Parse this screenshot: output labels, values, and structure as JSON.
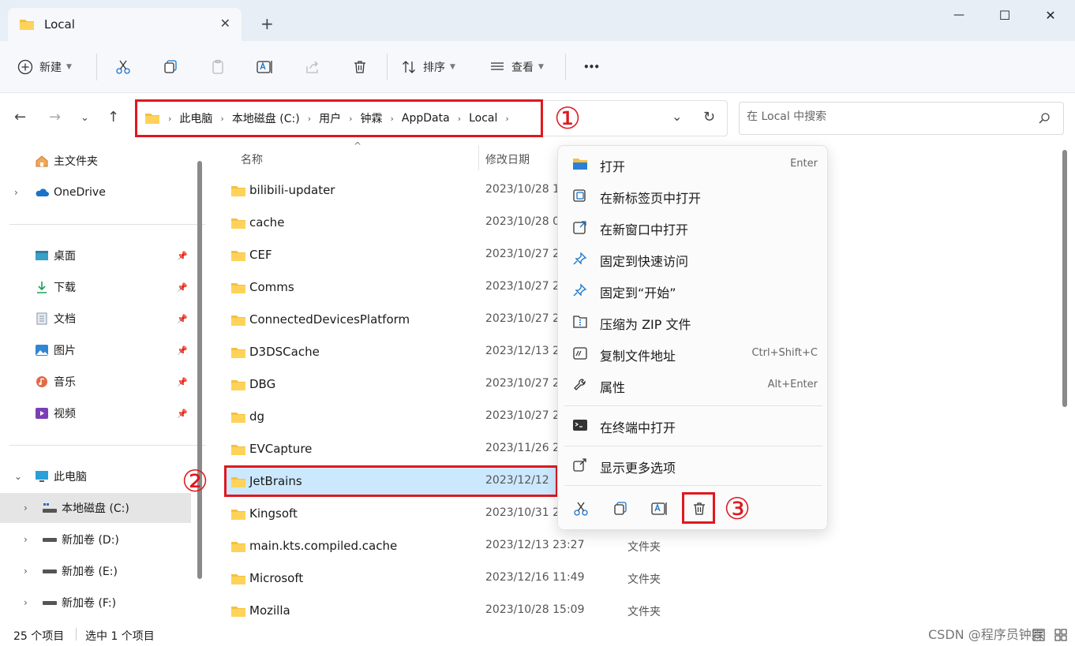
{
  "window": {
    "tab_title": "Local",
    "new_tab": "+",
    "close_tab": "✕",
    "minimize": "—",
    "maximize": "☐",
    "close": "✕"
  },
  "toolbar": {
    "new_label": "新建",
    "sort_label": "排序",
    "view_label": "查看",
    "more_label": "•••"
  },
  "address": {
    "crumbs": [
      "此电脑",
      "本地磁盘 (C:)",
      "用户",
      "钟霖",
      "AppData",
      "Local"
    ],
    "annotation": "①"
  },
  "search": {
    "placeholder": "在 Local 中搜索"
  },
  "sidebar": {
    "items": [
      {
        "label": "主文件夹",
        "icon": "home-icon"
      },
      {
        "label": "OneDrive",
        "icon": "cloud-icon"
      },
      {
        "label": "桌面",
        "icon": "desktop-icon"
      },
      {
        "label": "下载",
        "icon": "download-icon"
      },
      {
        "label": "文档",
        "icon": "document-icon"
      },
      {
        "label": "图片",
        "icon": "pictures-icon"
      },
      {
        "label": "音乐",
        "icon": "music-icon"
      },
      {
        "label": "视频",
        "icon": "video-icon"
      },
      {
        "label": "此电脑",
        "icon": "pc-icon"
      },
      {
        "label": "本地磁盘 (C:)",
        "icon": "drive-icon"
      },
      {
        "label": "新加卷 (D:)",
        "icon": "drive-icon"
      },
      {
        "label": "新加卷 (E:)",
        "icon": "drive-icon"
      },
      {
        "label": "新加卷 (F:)",
        "icon": "drive-icon"
      }
    ]
  },
  "list": {
    "col_name": "名称",
    "col_date": "修改日期",
    "rows": [
      {
        "name": "bilibili-updater",
        "date": "2023/10/28 1",
        "type": ""
      },
      {
        "name": "cache",
        "date": "2023/10/28 0",
        "type": ""
      },
      {
        "name": "CEF",
        "date": "2023/10/27 2",
        "type": ""
      },
      {
        "name": "Comms",
        "date": "2023/10/27 2",
        "type": ""
      },
      {
        "name": "ConnectedDevicesPlatform",
        "date": "2023/10/27 2",
        "type": ""
      },
      {
        "name": "D3DSCache",
        "date": "2023/12/13 2",
        "type": ""
      },
      {
        "name": "DBG",
        "date": "2023/10/27 2",
        "type": ""
      },
      {
        "name": "dg",
        "date": "2023/10/27 2",
        "type": ""
      },
      {
        "name": "EVCapture",
        "date": "2023/11/26 2",
        "type": ""
      },
      {
        "name": "JetBrains",
        "date": "2023/12/12",
        "type": ""
      },
      {
        "name": "Kingsoft",
        "date": "2023/10/31 2",
        "type": ""
      },
      {
        "name": "main.kts.compiled.cache",
        "date": "2023/12/13 23:27",
        "type": "文件夹"
      },
      {
        "name": "Microsoft",
        "date": "2023/12/16 11:49",
        "type": "文件夹"
      },
      {
        "name": "Mozilla",
        "date": "2023/10/28 15:09",
        "type": "文件夹"
      }
    ],
    "annotation": "②"
  },
  "context_menu": {
    "items": [
      {
        "label": "打开",
        "shortcut": "Enter",
        "icon": "folder-open-icon"
      },
      {
        "label": "在新标签页中打开",
        "shortcut": "",
        "icon": "new-tab-icon"
      },
      {
        "label": "在新窗口中打开",
        "shortcut": "",
        "icon": "new-window-icon"
      },
      {
        "label": "固定到快速访问",
        "shortcut": "",
        "icon": "pin-icon"
      },
      {
        "label": "固定到“开始”",
        "shortcut": "",
        "icon": "pin-icon"
      },
      {
        "label": "压缩为 ZIP 文件",
        "shortcut": "",
        "icon": "zip-icon"
      },
      {
        "label": "复制文件地址",
        "shortcut": "Ctrl+Shift+C",
        "icon": "copy-path-icon"
      },
      {
        "label": "属性",
        "shortcut": "Alt+Enter",
        "icon": "wrench-icon"
      },
      {
        "label": "在终端中打开",
        "shortcut": "",
        "icon": "terminal-icon"
      },
      {
        "label": "显示更多选项",
        "shortcut": "",
        "icon": "more-options-icon"
      }
    ],
    "annotation": "③"
  },
  "status": {
    "count": "25 个项目",
    "selected": "选中 1 个项目"
  },
  "watermark": "CSDN @程序员钟霖",
  "colors": {
    "annotation_red": "#e0181f",
    "selection": "#cce8ff",
    "folder": "#f4c03f",
    "accent_blue": "#1a73c9"
  }
}
